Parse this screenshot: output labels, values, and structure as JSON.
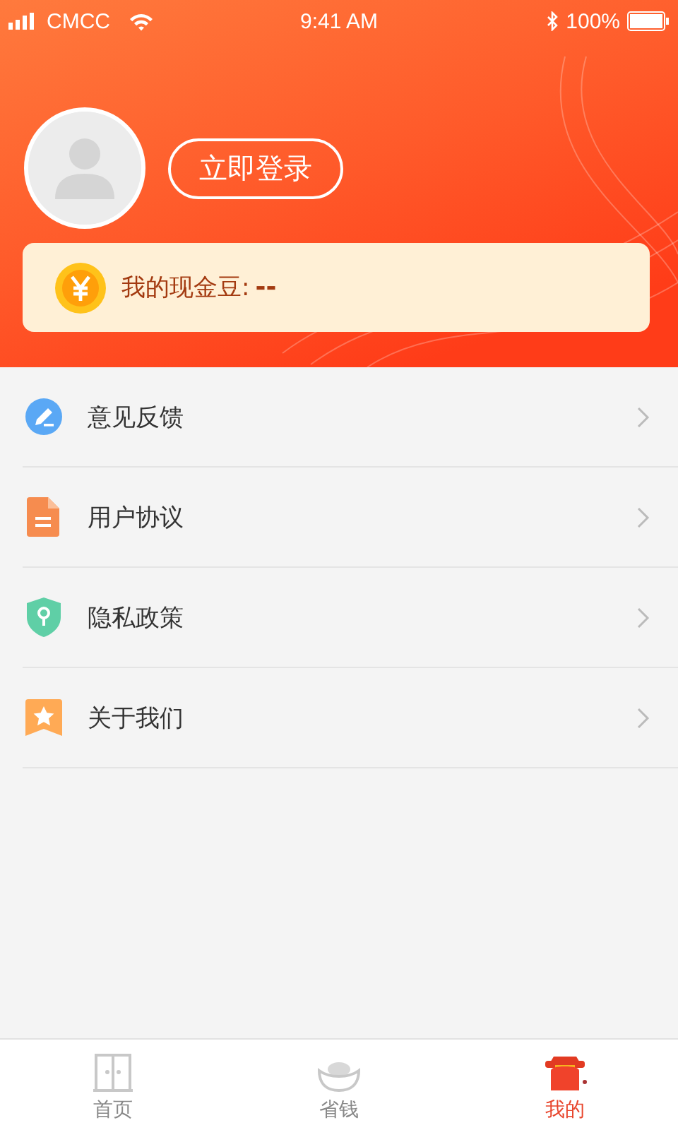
{
  "status_bar": {
    "carrier": "CMCC",
    "time": "9:41 AM",
    "battery": "100%"
  },
  "profile": {
    "login_button": "立即登录",
    "cash_beans": {
      "label": "我的现金豆:",
      "value": "--"
    }
  },
  "menu": [
    {
      "kind": "feedback",
      "label": "意见反馈"
    },
    {
      "kind": "agreement",
      "label": "用户协议"
    },
    {
      "kind": "privacy",
      "label": "隐私政策"
    },
    {
      "kind": "about",
      "label": "关于我们"
    }
  ],
  "tab_bar": [
    {
      "kind": "home",
      "label": "首页",
      "selected": false
    },
    {
      "kind": "save",
      "label": "省钱",
      "selected": false
    },
    {
      "kind": "mine",
      "label": "我的",
      "selected": true
    }
  ]
}
